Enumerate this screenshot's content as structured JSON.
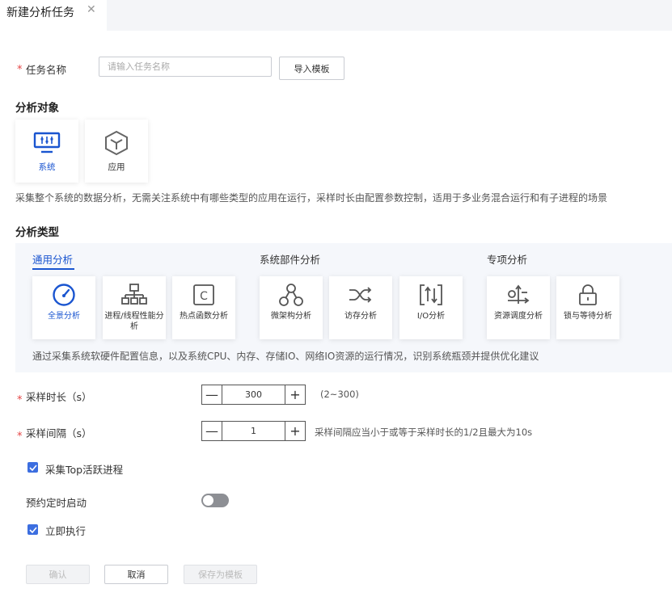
{
  "tab": {
    "title": "新建分析任务",
    "close": "✕"
  },
  "form": {
    "task_name": {
      "required": "*",
      "label": "任务名称",
      "placeholder": "请输入任务名称",
      "value": ""
    },
    "import_template": "导入模板"
  },
  "analysis_object": {
    "title": "分析对象",
    "cards": [
      {
        "label": "系统",
        "icon": "monitor-icon",
        "selected": true
      },
      {
        "label": "应用",
        "icon": "cube-icon",
        "selected": false
      }
    ],
    "description": "采集整个系统的数据分析，无需关注系统中有哪些类型的应用在运行，采样时长由配置参数控制，适用于多业务混合运行和有子进程的场景"
  },
  "analysis_type": {
    "title": "分析类型",
    "groups": [
      {
        "name": "通用分析",
        "active": true
      },
      {
        "name": "系统部件分析",
        "active": false
      },
      {
        "name": "专项分析",
        "active": false
      }
    ],
    "cards": [
      {
        "label": "全景分析",
        "icon": "gauge-icon",
        "selected": true
      },
      {
        "label": "进程/线程性能分析",
        "icon": "hierarchy-icon",
        "selected": false
      },
      {
        "label": "热点函数分析",
        "icon": "c-function-icon",
        "selected": false
      },
      {
        "label": "微架构分析",
        "icon": "nodes-icon",
        "selected": false
      },
      {
        "label": "访存分析",
        "icon": "shuffle-icon",
        "selected": false
      },
      {
        "label": "I/O分析",
        "icon": "io-icon",
        "selected": false
      },
      {
        "label": "资源调度分析",
        "icon": "schedule-icon",
        "selected": false
      },
      {
        "label": "锁与等待分析",
        "icon": "lock-icon",
        "selected": false
      }
    ],
    "description": "通过采集系统软硬件配置信息，以及系统CPU、内存、存储IO、网络IO资源的运行情况，识别系统瓶颈并提供优化建议"
  },
  "sampling_duration": {
    "required": "*",
    "label": "采样时长（s）",
    "minus": "—",
    "plus": "+",
    "value": "300",
    "hint": "(2~300)"
  },
  "sampling_interval": {
    "required": "*",
    "label": "采样间隔（s）",
    "minus": "—",
    "plus": "+",
    "value": "1",
    "hint": "采样间隔应当小于或等于采样时长的1/2且最大为10s"
  },
  "options": {
    "collect_top": {
      "label": "采集Top活跃进程",
      "checked": true
    },
    "scheduled_start": {
      "label": "预约定时启动",
      "on": false
    },
    "run_now": {
      "label": "立即执行",
      "checked": true
    }
  },
  "buttons": {
    "confirm": "确认",
    "cancel": "取消",
    "save_template": "保存为模板"
  },
  "colors": {
    "accent": "#1a55d0",
    "required": "#e54545",
    "checkbox": "#3c6ee0"
  }
}
